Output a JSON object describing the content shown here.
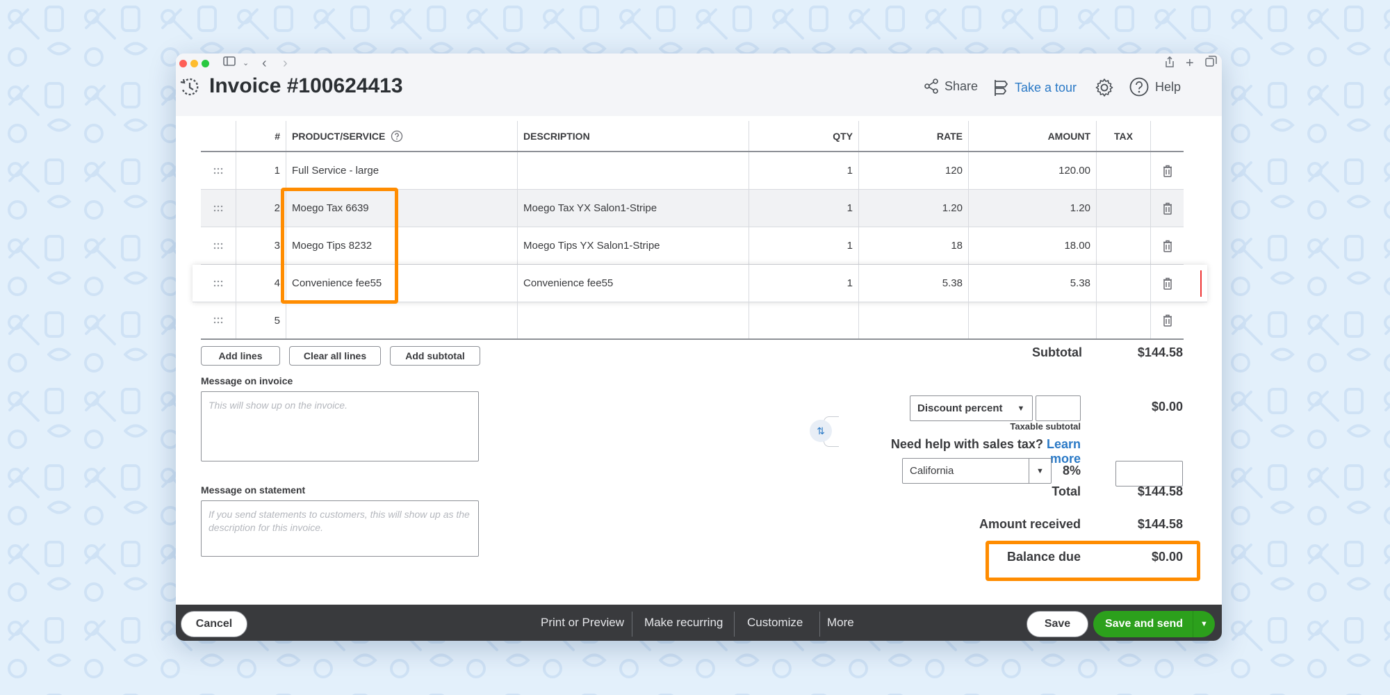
{
  "window": {
    "title": "Invoice #100624413"
  },
  "header": {
    "share_label": "Share",
    "tour_label": "Take a tour",
    "help_label": "Help"
  },
  "table": {
    "columns": [
      "#",
      "PRODUCT/SERVICE",
      "DESCRIPTION",
      "QTY",
      "RATE",
      "AMOUNT",
      "TAX"
    ],
    "rows": [
      {
        "num": "1",
        "product": "Full Service - large",
        "description": "",
        "qty": "1",
        "rate": "120",
        "amount": "120.00"
      },
      {
        "num": "2",
        "product": "Moego Tax 6639",
        "description": "Moego Tax YX Salon1-Stripe",
        "qty": "1",
        "rate": "1.20",
        "amount": "1.20"
      },
      {
        "num": "3",
        "product": "Moego Tips 8232",
        "description": "Moego Tips YX Salon1-Stripe",
        "qty": "1",
        "rate": "18",
        "amount": "18.00"
      },
      {
        "num": "4",
        "product": "Convenience fee55",
        "description": "Convenience fee55",
        "qty": "1",
        "rate": "5.38",
        "amount": "5.38"
      },
      {
        "num": "5",
        "product": "",
        "description": "",
        "qty": "",
        "rate": "",
        "amount": ""
      }
    ]
  },
  "line_actions": {
    "add_lines": "Add lines",
    "clear_all_lines": "Clear all lines",
    "add_subtotal": "Add subtotal"
  },
  "messages": {
    "invoice_label": "Message on invoice",
    "invoice_placeholder": "This will show up on the invoice.",
    "statement_label": "Message on statement",
    "statement_placeholder": "If you send statements to customers, this will show up as the description for this invoice."
  },
  "summary": {
    "subtotal_label": "Subtotal",
    "subtotal_value": "$144.58",
    "discount_select": "Discount percent",
    "discount_value": "$0.00",
    "taxable_subtotal_label": "Taxable subtotal",
    "tax_help_text": "Need help with sales tax?",
    "tax_help_link": "Learn more",
    "tax_region": "California",
    "tax_rate": "8%",
    "total_label": "Total",
    "total_value": "$144.58",
    "amount_received_label": "Amount received",
    "amount_received_value": "$144.58",
    "balance_due_label": "Balance due",
    "balance_due_value": "$0.00"
  },
  "footer": {
    "cancel": "Cancel",
    "print_preview": "Print or Preview",
    "make_recurring": "Make recurring",
    "customize": "Customize",
    "more": "More",
    "save": "Save",
    "save_and_send": "Save and send"
  },
  "colors": {
    "highlight": "#ff8c00",
    "primary_green": "#2ca01c",
    "link_blue": "#2a79c6",
    "footer_bg": "#393a3d",
    "page_bg": "#e3f0fb"
  },
  "icons": [
    "drag-handle-icon",
    "trash-icon",
    "help-circle-icon",
    "share-icon",
    "tour-icon",
    "gear-icon",
    "help-icon",
    "history-icon",
    "swap-icon",
    "chevron-down-icon"
  ]
}
